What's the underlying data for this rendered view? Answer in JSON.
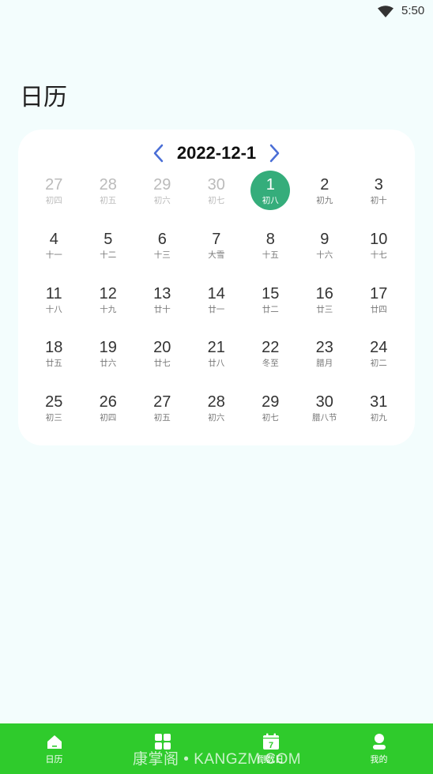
{
  "status": {
    "time": "5:50",
    "wifi_icon": "wifi-icon"
  },
  "page": {
    "title": "日历"
  },
  "calendar": {
    "month_label": "2022-12-1",
    "prev_icon": "chevron-left-icon",
    "next_icon": "chevron-right-icon",
    "accent_color": "#35ad7b",
    "nav_arrow_color": "#4a6ed6",
    "weeks": [
      [
        {
          "d": "27",
          "l": "初四",
          "other": true
        },
        {
          "d": "28",
          "l": "初五",
          "other": true
        },
        {
          "d": "29",
          "l": "初六",
          "other": true
        },
        {
          "d": "30",
          "l": "初七",
          "other": true
        },
        {
          "d": "1",
          "l": "初八",
          "selected": true
        },
        {
          "d": "2",
          "l": "初九"
        },
        {
          "d": "3",
          "l": "初十"
        }
      ],
      [
        {
          "d": "4",
          "l": "十一"
        },
        {
          "d": "5",
          "l": "十二"
        },
        {
          "d": "6",
          "l": "十三"
        },
        {
          "d": "7",
          "l": "大雪"
        },
        {
          "d": "8",
          "l": "十五"
        },
        {
          "d": "9",
          "l": "十六"
        },
        {
          "d": "10",
          "l": "十七"
        }
      ],
      [
        {
          "d": "11",
          "l": "十八"
        },
        {
          "d": "12",
          "l": "十九"
        },
        {
          "d": "13",
          "l": "廿十"
        },
        {
          "d": "14",
          "l": "廿一"
        },
        {
          "d": "15",
          "l": "廿二"
        },
        {
          "d": "16",
          "l": "廿三"
        },
        {
          "d": "17",
          "l": "廿四"
        }
      ],
      [
        {
          "d": "18",
          "l": "廿五"
        },
        {
          "d": "19",
          "l": "廿六"
        },
        {
          "d": "20",
          "l": "廿七"
        },
        {
          "d": "21",
          "l": "廿八"
        },
        {
          "d": "22",
          "l": "冬至"
        },
        {
          "d": "23",
          "l": "腊月"
        },
        {
          "d": "24",
          "l": "初二"
        }
      ],
      [
        {
          "d": "25",
          "l": "初三"
        },
        {
          "d": "26",
          "l": "初四"
        },
        {
          "d": "27",
          "l": "初五"
        },
        {
          "d": "28",
          "l": "初六"
        },
        {
          "d": "29",
          "l": "初七"
        },
        {
          "d": "30",
          "l": "腊八节"
        },
        {
          "d": "31",
          "l": "初九"
        }
      ]
    ]
  },
  "bottom_nav": {
    "background": "#2fcb2c",
    "items": [
      {
        "label": "日历",
        "icon": "home-icon"
      },
      {
        "label": "",
        "icon": "grid-icon"
      },
      {
        "label": "倒数日",
        "icon": "calendar-7-icon"
      },
      {
        "label": "我的",
        "icon": "person-icon"
      }
    ]
  },
  "watermark": "康掌阁 • KANGZM.COM"
}
